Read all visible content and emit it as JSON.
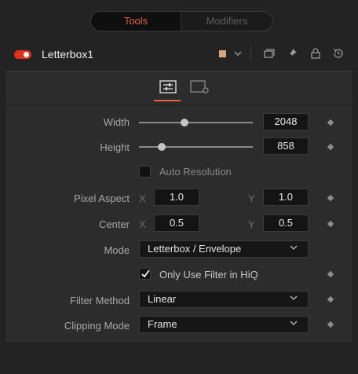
{
  "tabs": {
    "tools": "Tools",
    "modifiers": "Modifiers"
  },
  "tool": {
    "name": "Letterbox1",
    "swatch_color": "#d8a981",
    "accent": "#e0301e"
  },
  "width": {
    "label": "Width",
    "value": "2048",
    "level": 0.4
  },
  "height": {
    "label": "Height",
    "value": "858",
    "level": 0.2
  },
  "auto_resolution": {
    "label": "Auto Resolution",
    "checked": false
  },
  "pixel_aspect": {
    "label": "Pixel Aspect",
    "x_label": "X",
    "x_value": "1.0",
    "y_label": "Y",
    "y_value": "1.0"
  },
  "center": {
    "label": "Center",
    "x_label": "X",
    "x_value": "0.5",
    "y_label": "Y",
    "y_value": "0.5"
  },
  "mode": {
    "label": "Mode",
    "value": "Letterbox / Envelope"
  },
  "hiq": {
    "label": "Only Use Filter in HiQ",
    "checked": true
  },
  "filter_method": {
    "label": "Filter Method",
    "value": "Linear"
  },
  "clipping_mode": {
    "label": "Clipping Mode",
    "value": "Frame"
  }
}
